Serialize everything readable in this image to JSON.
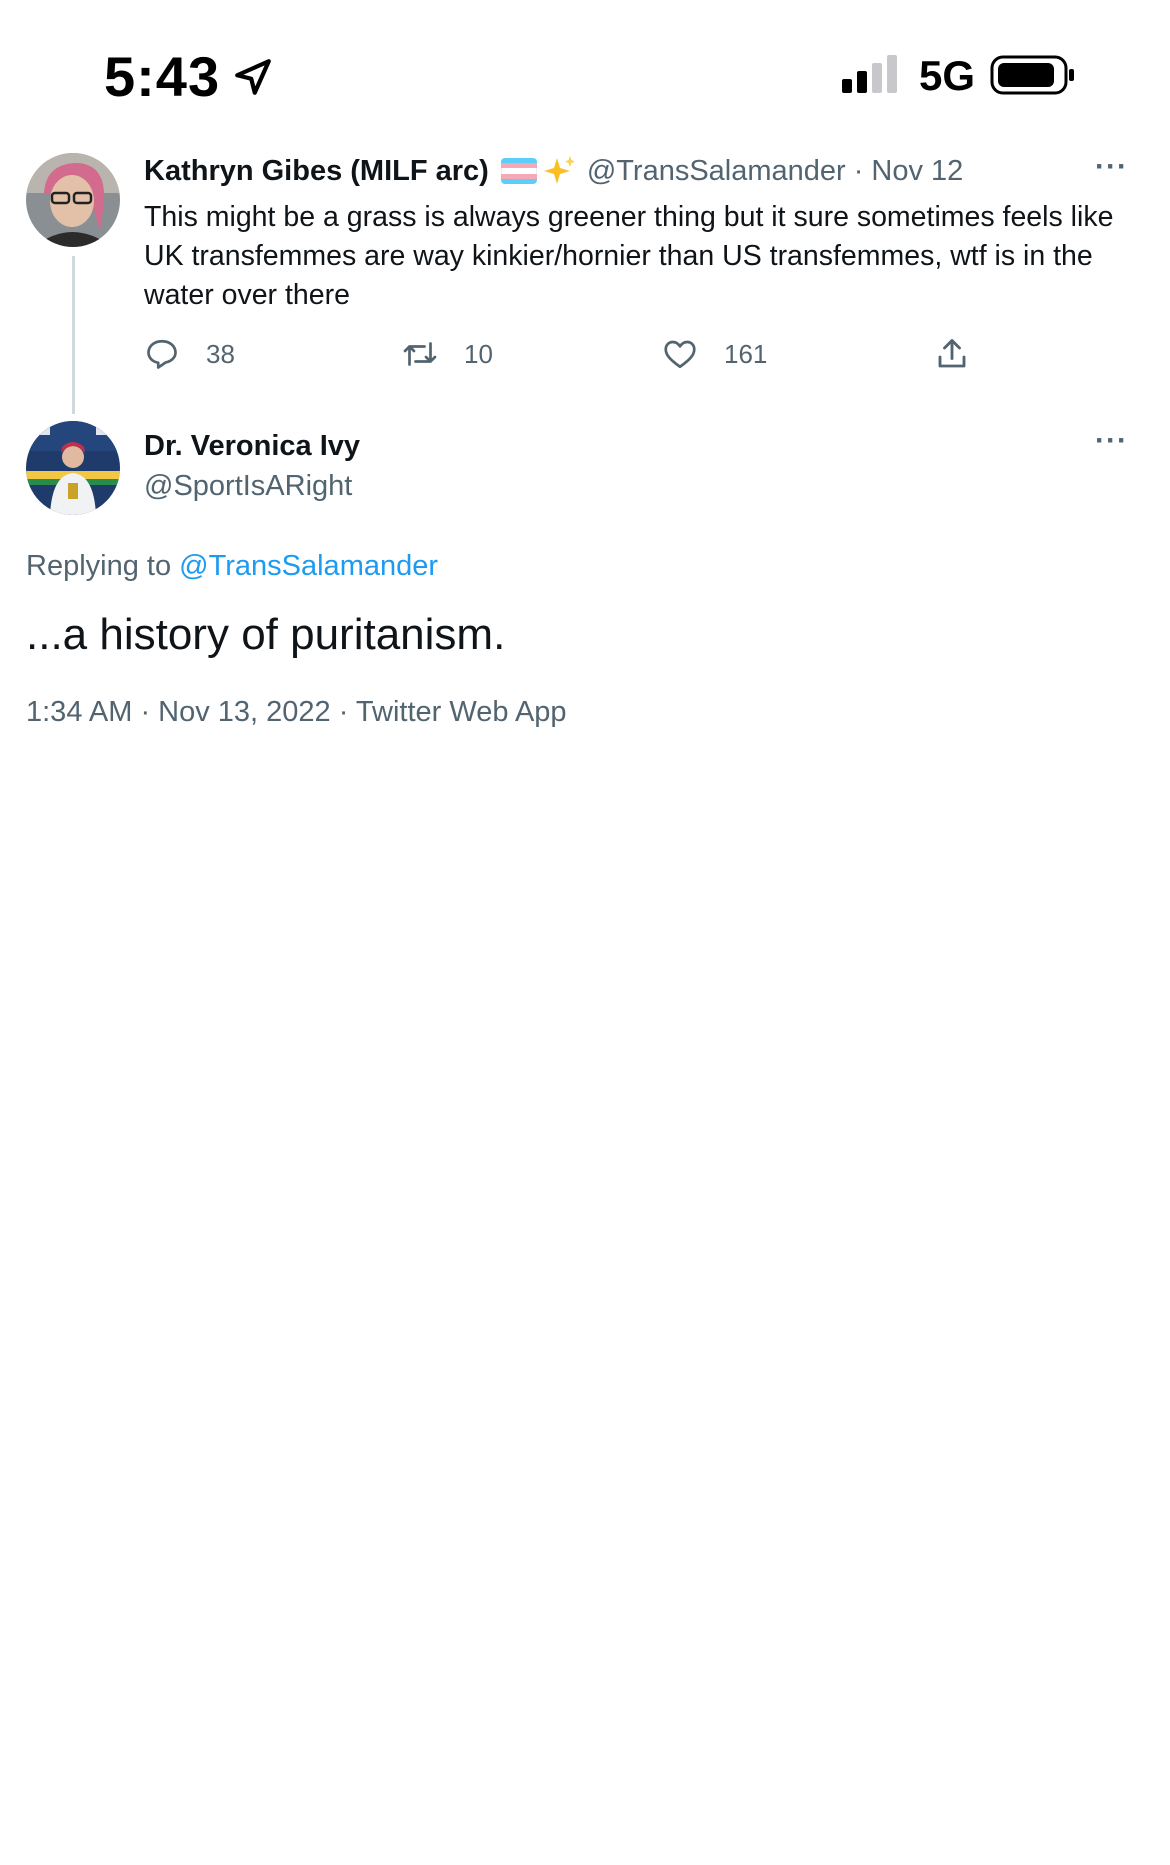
{
  "status_bar": {
    "time": "5:43",
    "network": "5G"
  },
  "parent_tweet": {
    "author_name": "Kathryn Gibes (MILF arc)",
    "handle": "@TransSalamander",
    "separator": "·",
    "date": "Nov 12",
    "text": "This might be a grass is always greener thing but it sure sometimes feels like UK transfemmes are way kinkier/hornier than US transfemmes, wtf is in the water over there",
    "more_label": "···",
    "replies": "38",
    "retweets": "10",
    "likes": "161"
  },
  "main_tweet": {
    "author_name": "Dr. Veronica Ivy",
    "handle": "@SportIsARight",
    "more_label": "···",
    "replying_prefix": "Replying to",
    "replying_handle": "@TransSalamander",
    "text": "...a history of puritanism.",
    "meta": "1:34 AM · Nov 13, 2022 · Twitter Web App"
  },
  "colors": {
    "link": "#1d9bf0",
    "secondary_text": "#536471",
    "primary_text": "#0f1419",
    "thread_line": "#cfd9de",
    "trans_flag_blue": "#5bcefa",
    "trans_flag_pink": "#f5a9b8",
    "trans_flag_white": "#ffffff",
    "sparkle": "#fbbf24"
  },
  "icons": {
    "location": "location-arrow-icon",
    "signal": "cellular-signal-icon",
    "battery": "battery-icon",
    "reply": "reply-icon",
    "retweet": "retweet-icon",
    "like": "heart-icon",
    "share": "share-icon",
    "sparkle": "sparkles-icon",
    "flag": "transgender-flag-icon"
  }
}
